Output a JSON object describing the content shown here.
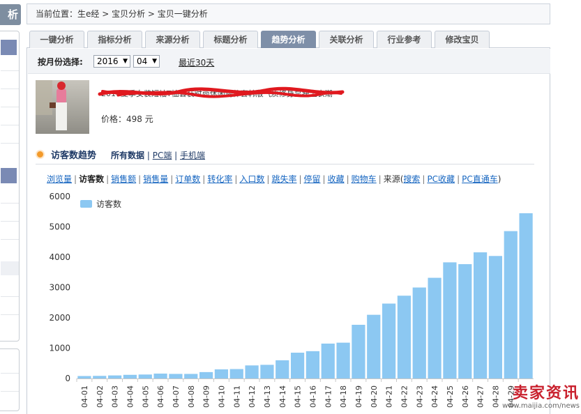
{
  "sidebar": {
    "head_char": "析"
  },
  "breadcrumb": "当前位置：生e经 > 宝贝分析 > 宝贝一键分析",
  "tabs": [
    {
      "label": "一键分析",
      "active": false
    },
    {
      "label": "指标分析",
      "active": false
    },
    {
      "label": "来源分析",
      "active": false
    },
    {
      "label": "标题分析",
      "active": false
    },
    {
      "label": "趋势分析",
      "active": true
    },
    {
      "label": "关联分析",
      "active": false
    },
    {
      "label": "行业参考",
      "active": false
    },
    {
      "label": "修改宝贝",
      "active": false
    }
  ],
  "filter": {
    "label": "按月份选择:",
    "year": "2016",
    "month": "04",
    "recent_link": "最近30天"
  },
  "product": {
    "title_scribbled": "2016夏季女装短袖T恤套装时尚休闲两件套韩版气质修身显瘦上衣潮",
    "price": "价格：498 元"
  },
  "section": {
    "title": "访客数趋势",
    "all_data": "所有数据",
    "pc": "PC端",
    "mobile": "手机端"
  },
  "metrics": {
    "items": [
      "浏览量",
      "访客数",
      "销售额",
      "销售量",
      "订单数",
      "转化率",
      "入口数",
      "跳失率",
      "停留",
      "收藏",
      "购物车"
    ],
    "current": "访客数",
    "source_prefix": "来源(",
    "sources": [
      "搜索",
      "PC收藏",
      "PC直通车"
    ],
    "source_suffix": ")"
  },
  "colors": {
    "bar": "#8cc8f2",
    "accent": "#7e8fa8",
    "title_scribble": "#e0191f"
  },
  "chart_data": {
    "type": "bar",
    "legend": "访客数",
    "legend_position": "top-left",
    "grid": false,
    "ylim": [
      0,
      6000
    ],
    "yticks": [
      0,
      1000,
      2000,
      3000,
      4000,
      5000,
      6000
    ],
    "categories": [
      "04-01",
      "04-02",
      "04-03",
      "04-04",
      "04-05",
      "04-06",
      "04-07",
      "04-08",
      "04-09",
      "04-10",
      "04-11",
      "04-12",
      "04-13",
      "04-14",
      "04-15",
      "04-16",
      "04-17",
      "04-18",
      "04-19",
      "04-20",
      "04-21",
      "04-22",
      "04-23",
      "04-24",
      "04-25",
      "04-26",
      "04-27",
      "04-28",
      "04-29"
    ],
    "values": [
      80,
      85,
      100,
      120,
      130,
      160,
      150,
      150,
      210,
      300,
      310,
      430,
      450,
      600,
      850,
      900,
      1150,
      1180,
      1770,
      2100,
      2470,
      2730,
      3000,
      3320,
      3830,
      3770,
      4160,
      4040,
      4860,
      5450
    ]
  },
  "watermark": {
    "big": "卖家资讯",
    "small": "www.maijia.com/news"
  }
}
